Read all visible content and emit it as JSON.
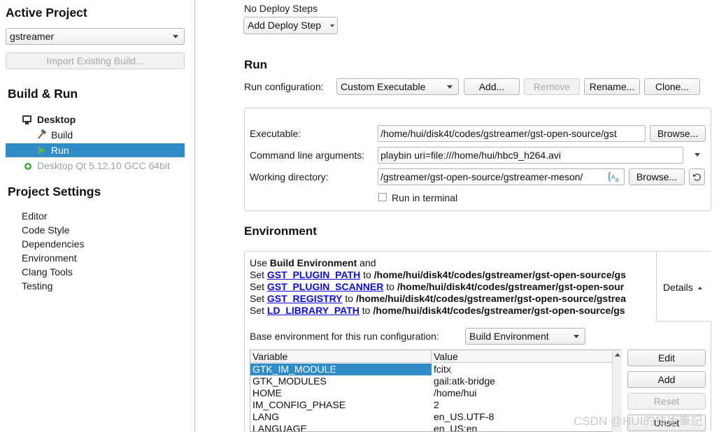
{
  "sidebar": {
    "active_project_title": "Active Project",
    "project_combo": "gstreamer",
    "import_button": "Import Existing Build...",
    "build_run_title": "Build & Run",
    "kits": [
      {
        "label": "Desktop"
      },
      {
        "label": "Build"
      },
      {
        "label": "Run"
      },
      {
        "label": "Desktop Qt 5.12.10 GCC 64bit"
      }
    ],
    "project_settings_title": "Project Settings",
    "settings_items": [
      "Editor",
      "Code Style",
      "Dependencies",
      "Environment",
      "Clang Tools",
      "Testing"
    ]
  },
  "deploy": {
    "no_steps": "No Deploy Steps",
    "add_step": "Add Deploy Step"
  },
  "run": {
    "title": "Run",
    "config_label": "Run configuration:",
    "config_value": "Custom Executable",
    "add": "Add...",
    "remove": "Remove",
    "rename": "Rename...",
    "clone": "Clone...",
    "executable_label": "Executable:",
    "executable_value": "/home/hui/disk4t/codes/gstreamer/gst-open-source/gst",
    "browse": "Browse...",
    "args_label": "Command line arguments:",
    "args_value": "playbin uri=file:///home/hui/hbc9_h264.avi",
    "workdir_label": "Working directory:",
    "workdir_value": "/gstreamer/gst-open-source/gstreamer-meson/",
    "run_in_terminal": "Run in terminal"
  },
  "environment": {
    "title": "Environment",
    "use_prefix": "Use ",
    "use_bold": "Build Environment",
    "use_suffix": " and",
    "lines": [
      {
        "set": "Set ",
        "var": "GST_PLUGIN_PATH",
        "to": " to ",
        "value": "/home/hui/disk4t/codes/gstreamer/gst-open-source/gs"
      },
      {
        "set": "Set ",
        "var": "GST_PLUGIN_SCANNER",
        "to": " to ",
        "value": "/home/hui/disk4t/codes/gstreamer/gst-open-sour"
      },
      {
        "set": "Set ",
        "var": "GST_REGISTRY",
        "to": " to ",
        "value": "/home/hui/disk4t/codes/gstreamer/gst-open-source/gstrea"
      },
      {
        "set": "Set ",
        "var": "LD_LIBRARY_PATH",
        "to": " to ",
        "value": "/home/hui/disk4t/codes/gstreamer/gst-open-source/gs"
      }
    ],
    "details": "Details",
    "base_label": "Base environment for this run configuration:",
    "base_value": "Build Environment",
    "table": {
      "headers": [
        "Variable",
        "Value"
      ],
      "rows": [
        [
          "GTK_IM_MODULE",
          "fcitx"
        ],
        [
          "GTK_MODULES",
          "gail:atk-bridge"
        ],
        [
          "HOME",
          "/home/hui"
        ],
        [
          "IM_CONFIG_PHASE",
          "2"
        ],
        [
          "LANG",
          "en_US.UTF-8"
        ],
        [
          "LANGUAGE",
          "en_US:en"
        ]
      ]
    },
    "edit": "Edit",
    "add": "Add",
    "reset": "Reset",
    "unset": "Unset"
  },
  "watermark": "CSDN @HUI的技術筆記",
  "colors": {
    "selection": "#308cc6",
    "link": "#0b0bd9"
  }
}
